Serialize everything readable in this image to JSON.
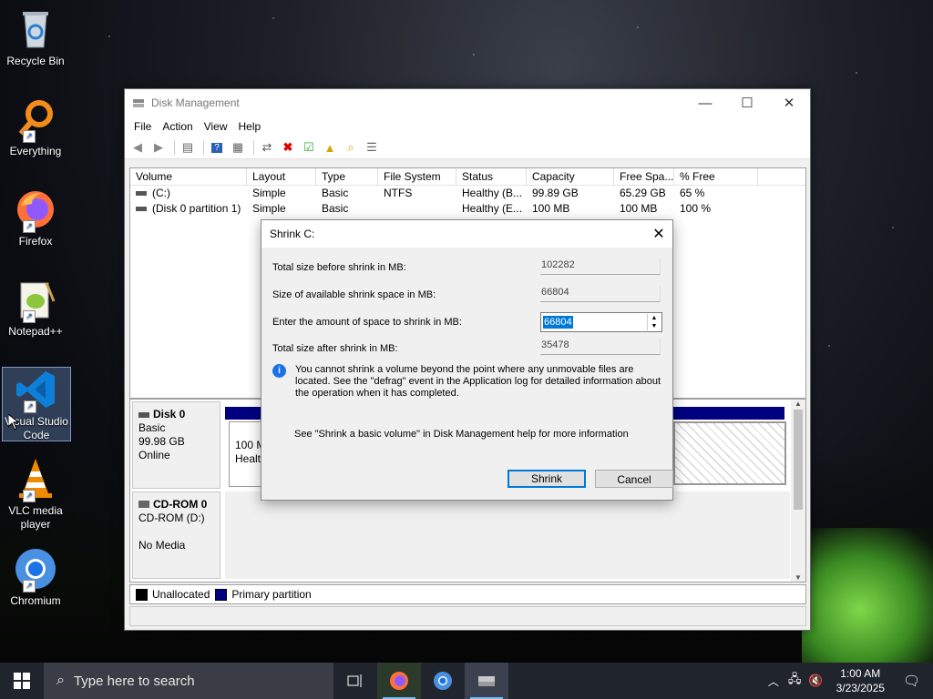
{
  "desktop": {
    "icons": [
      {
        "label": "Recycle Bin"
      },
      {
        "label": "Everything"
      },
      {
        "label": "Firefox"
      },
      {
        "label": "Notepad++"
      },
      {
        "label": "Visual Studio Code"
      },
      {
        "label": "VLC media player"
      },
      {
        "label": "Chromium"
      }
    ]
  },
  "window": {
    "title": "Disk Management",
    "menu": [
      "File",
      "Action",
      "View",
      "Help"
    ],
    "columns": [
      "Volume",
      "Layout",
      "Type",
      "File System",
      "Status",
      "Capacity",
      "Free Spa...",
      "% Free"
    ],
    "rows": [
      [
        "(C:)",
        "Simple",
        "Basic",
        "NTFS",
        "Healthy (B...",
        "99.89 GB",
        "65.29 GB",
        "65 %"
      ],
      [
        "(Disk 0 partition 1)",
        "Simple",
        "Basic",
        "",
        "Healthy (E...",
        "100 MB",
        "100 MB",
        "100 %"
      ]
    ],
    "disk0": {
      "name": "Disk 0",
      "type": "Basic",
      "size": "99.98 GB",
      "status": "Online",
      "partition_size": "100 M",
      "partition_status": "Health"
    },
    "cdrom": {
      "name": "CD-ROM 0",
      "drive": "CD-ROM (D:)",
      "status": "No Media"
    },
    "legend": {
      "unallocated": "Unallocated",
      "primary": "Primary partition"
    }
  },
  "dialog": {
    "title": "Shrink C:",
    "total_before_label": "Total size before shrink in MB:",
    "total_before_value": "102282",
    "available_label": "Size of available shrink space in MB:",
    "available_value": "66804",
    "enter_label": "Enter the amount of space to shrink in MB:",
    "enter_value": "66804",
    "total_after_label": "Total size after shrink in MB:",
    "total_after_value": "35478",
    "info_text": "You cannot shrink a volume beyond the point where any unmovable files are located. See the \"defrag\" event in the Application log for detailed information about the operation when it has completed.",
    "help_text": "See \"Shrink a basic volume\" in Disk Management help for more information",
    "shrink_button": "Shrink",
    "cancel_button": "Cancel"
  },
  "taskbar": {
    "search_placeholder": "Type here to search",
    "time": "1:00 AM",
    "date": "3/23/2025"
  },
  "colors": {
    "primary_partition": "#000080",
    "unallocated": "#000000",
    "accent": "#0078d7"
  }
}
